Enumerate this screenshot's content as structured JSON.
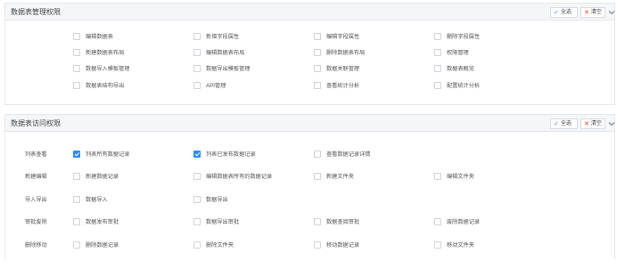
{
  "buttons": {
    "select_all": "全选",
    "clear": "清空"
  },
  "manage": {
    "title": "数据表管理权限",
    "items": [
      [
        "编辑数据表",
        "新增字段属性",
        "编辑字段属性",
        "删除字段属性"
      ],
      [
        "新建数据表布局",
        "编辑数据表布局",
        "删除数据表布局",
        "权限管理"
      ],
      [
        "数据导入模板管理",
        "数据导出模板管理",
        "数据关联管理",
        "数据表概览"
      ],
      [
        "数据表结构导出",
        "API管理",
        "查看统计分析",
        "配置统计分析"
      ]
    ]
  },
  "access": {
    "title": "数据表访问权限",
    "rows": [
      {
        "label": "列表查看",
        "items": [
          {
            "text": "列表所有数据记录",
            "checked": true
          },
          {
            "text": "列表已发布数据记录",
            "checked": true
          },
          {
            "text": "查看数据记录详情",
            "checked": false
          }
        ]
      },
      {
        "label": "新建编辑",
        "items": [
          {
            "text": "新建数据记录",
            "checked": false
          },
          {
            "text": "编辑数据表所有的数据记录",
            "checked": false
          },
          {
            "text": "新建文件夹",
            "checked": false
          },
          {
            "text": "编辑文件夹",
            "checked": false
          }
        ]
      },
      {
        "label": "导入导出",
        "items": [
          {
            "text": "数据导入",
            "checked": false
          },
          {
            "text": "数据导出",
            "checked": false
          }
        ]
      },
      {
        "label": "审批废除",
        "items": [
          {
            "text": "数据发布审批",
            "checked": false
          },
          {
            "text": "数据导出审批",
            "checked": false
          },
          {
            "text": "数据查阅审批",
            "checked": false
          },
          {
            "text": "废除数据记录",
            "checked": false
          }
        ]
      },
      {
        "label": "删除移动",
        "items": [
          {
            "text": "删除数据记录",
            "checked": false
          },
          {
            "text": "删除文件夹",
            "checked": false
          },
          {
            "text": "移动数据记录",
            "checked": false
          },
          {
            "text": "移动文件夹",
            "checked": false
          }
        ]
      }
    ]
  }
}
